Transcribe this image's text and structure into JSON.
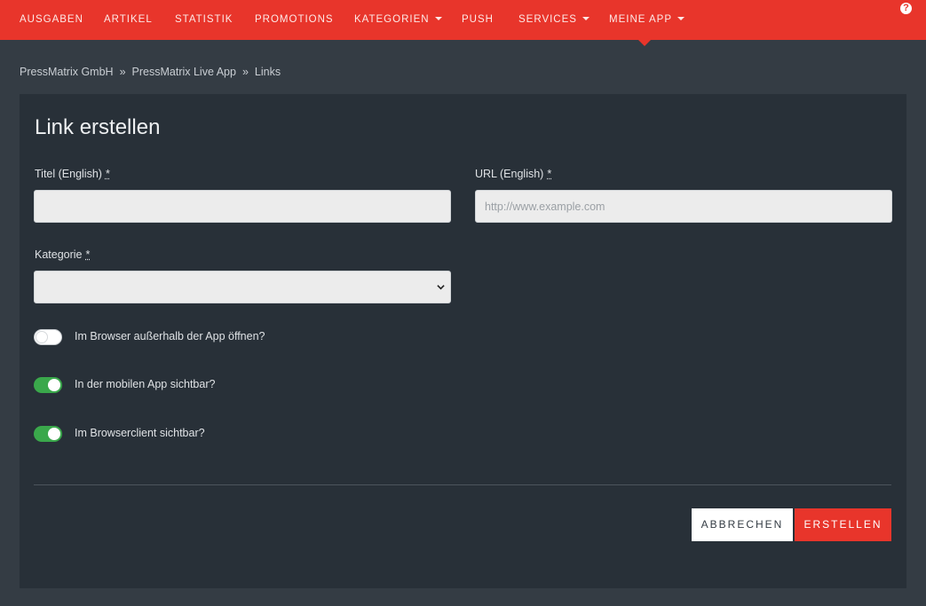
{
  "nav": {
    "items": [
      {
        "label": "AUSGABEN",
        "dropdown": false
      },
      {
        "label": "ARTIKEL",
        "dropdown": false
      },
      {
        "label": "STATISTIK",
        "dropdown": false
      },
      {
        "label": "PROMOTIONS",
        "dropdown": false
      },
      {
        "label": "KATEGORIEN",
        "dropdown": true
      },
      {
        "label": "PUSH",
        "dropdown": false
      },
      {
        "label": "SERVICES",
        "dropdown": true
      },
      {
        "label": "MEINE APP",
        "dropdown": true,
        "active": true
      }
    ],
    "help_icon": "question-circle-icon",
    "help_glyph": "?"
  },
  "breadcrumb": {
    "items": [
      "PressMatrix GmbH",
      "PressMatrix Live App",
      "Links"
    ],
    "separator": "»"
  },
  "form": {
    "title": "Link erstellen",
    "title_field": {
      "label": "Titel (English)",
      "required_mark": "*",
      "value": ""
    },
    "url_field": {
      "label": "URL (English)",
      "required_mark": "*",
      "value": "",
      "placeholder": "http://www.example.com"
    },
    "category_field": {
      "label": "Kategorie",
      "required_mark": "*",
      "selected": ""
    },
    "toggles": [
      {
        "label": "Im Browser außerhalb der App öffnen?",
        "checked": false
      },
      {
        "label": "In der mobilen App sichtbar?",
        "checked": true
      },
      {
        "label": "Im Browserclient sichtbar?",
        "checked": true
      }
    ],
    "cancel_label": "ABBRECHEN",
    "submit_label": "ERSTELLEN"
  },
  "colors": {
    "navbar": "#e8352b",
    "background": "#343c44",
    "panel": "#283038",
    "toggle_on": "#3aa84b",
    "primary_button": "#e8352b"
  }
}
